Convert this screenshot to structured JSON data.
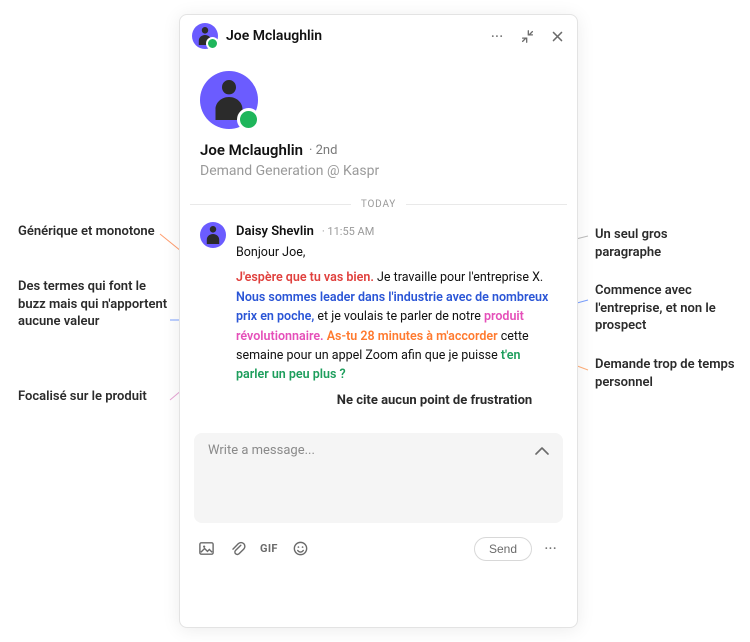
{
  "header": {
    "name": "Joe Mclaughlin"
  },
  "profile": {
    "name": "Joe Mclaughlin",
    "degree": "· 2nd",
    "role": "Demand Generation @ Kaspr"
  },
  "separator": {
    "label": "TODAY"
  },
  "message": {
    "from": "Daisy Shevlin",
    "time": "· 11:55 AM",
    "greeting": "Bonjour Joe,",
    "segments": [
      {
        "text": "J'espère que tu vas bien.",
        "cls": "c-red"
      },
      {
        "text": " Je travaille pour l'entreprise X. ",
        "cls": ""
      },
      {
        "text": "Nous sommes leader dans l'industrie avec de nombreux prix en poche,",
        "cls": "c-blue"
      },
      {
        "text": " et je voulais te parler de notre ",
        "cls": ""
      },
      {
        "text": "produit révolutionnaire.",
        "cls": "c-pink"
      },
      {
        "text": " ",
        "cls": ""
      },
      {
        "text": "As-tu 28 minutes à m'accorder",
        "cls": "c-orange"
      },
      {
        "text": " cette semaine pour un appel Zoom afin que je puisse ",
        "cls": ""
      },
      {
        "text": "t'en parler un peu plus ?",
        "cls": "c-green"
      }
    ]
  },
  "inside_annotation": "Ne cite aucun point de frustration",
  "composer": {
    "placeholder": "Write a message..."
  },
  "footer": {
    "gif": "GIF",
    "send": "Send"
  },
  "ann_left": [
    "Générique et monotone",
    "Des termes qui font le buzz mais qui n'apportent aucune valeur",
    "Focalisé sur le produit"
  ],
  "ann_right": [
    "Un seul gros paragraphe",
    "Commence avec l'entreprise, et non le prospect",
    "Demande trop de temps personnel"
  ]
}
